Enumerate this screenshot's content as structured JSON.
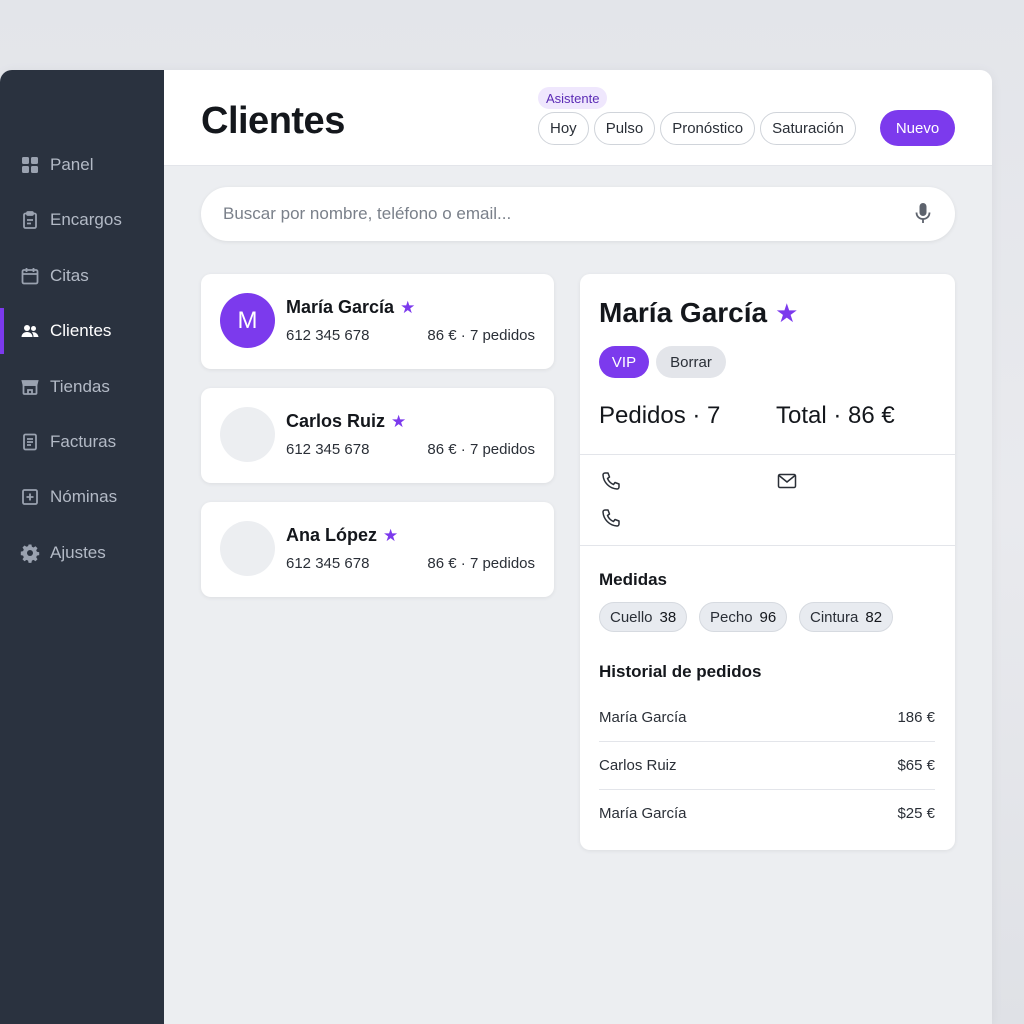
{
  "sidebar": {
    "items": [
      {
        "label": "Panel",
        "icon": "grid-icon"
      },
      {
        "label": "Encargos",
        "icon": "clipboard-icon"
      },
      {
        "label": "Citas",
        "icon": "calendar-icon"
      },
      {
        "label": "Clientes",
        "icon": "people-icon",
        "active": true
      },
      {
        "label": "Tiendas",
        "icon": "store-icon"
      },
      {
        "label": "Facturas",
        "icon": "document-icon"
      },
      {
        "label": "Nóminas",
        "icon": "plus-box-icon"
      },
      {
        "label": "Ajustes",
        "icon": "gear-icon"
      }
    ]
  },
  "header": {
    "title": "Clientes",
    "assistant_badge": "Asistente",
    "chips": [
      "Hoy",
      "Pulso",
      "Pronóstico",
      "Saturación"
    ],
    "new_button": "Nuevo"
  },
  "search": {
    "placeholder": "Buscar por nombre, teléfono o email..."
  },
  "clients": [
    {
      "name": "María García",
      "phone": "612 345 678",
      "stats": "86 € · 7 pedidos",
      "avatar_letter": "M",
      "starred": true
    },
    {
      "name": "Carlos Ruiz",
      "phone": "612 345 678",
      "stats": "86 € · 7 pedidos",
      "avatar_letter": "",
      "starred": true
    },
    {
      "name": "Ana López",
      "phone": "612 345 678",
      "stats": "86 € · 7 pedidos",
      "avatar_letter": "",
      "starred": true
    }
  ],
  "detail": {
    "name": "María García",
    "tag_vip": "VIP",
    "tag_delete": "Borrar",
    "orders": "Pedidos · 7",
    "total": "Total · 86 €",
    "measures_title": "Medidas",
    "measures": [
      {
        "label": "Cuello",
        "value": "38"
      },
      {
        "label": "Pecho",
        "value": "96"
      },
      {
        "label": "Cintura",
        "value": "82"
      }
    ],
    "history_title": "Historial de pedidos",
    "history": [
      {
        "name": "María García",
        "amount": "186 €"
      },
      {
        "name": "Carlos Ruiz",
        "amount": "$65 €"
      },
      {
        "name": "María García",
        "amount": "$25 €"
      }
    ]
  },
  "colors": {
    "accent": "#7c3aed",
    "sidebar_bg": "#2a323f"
  }
}
